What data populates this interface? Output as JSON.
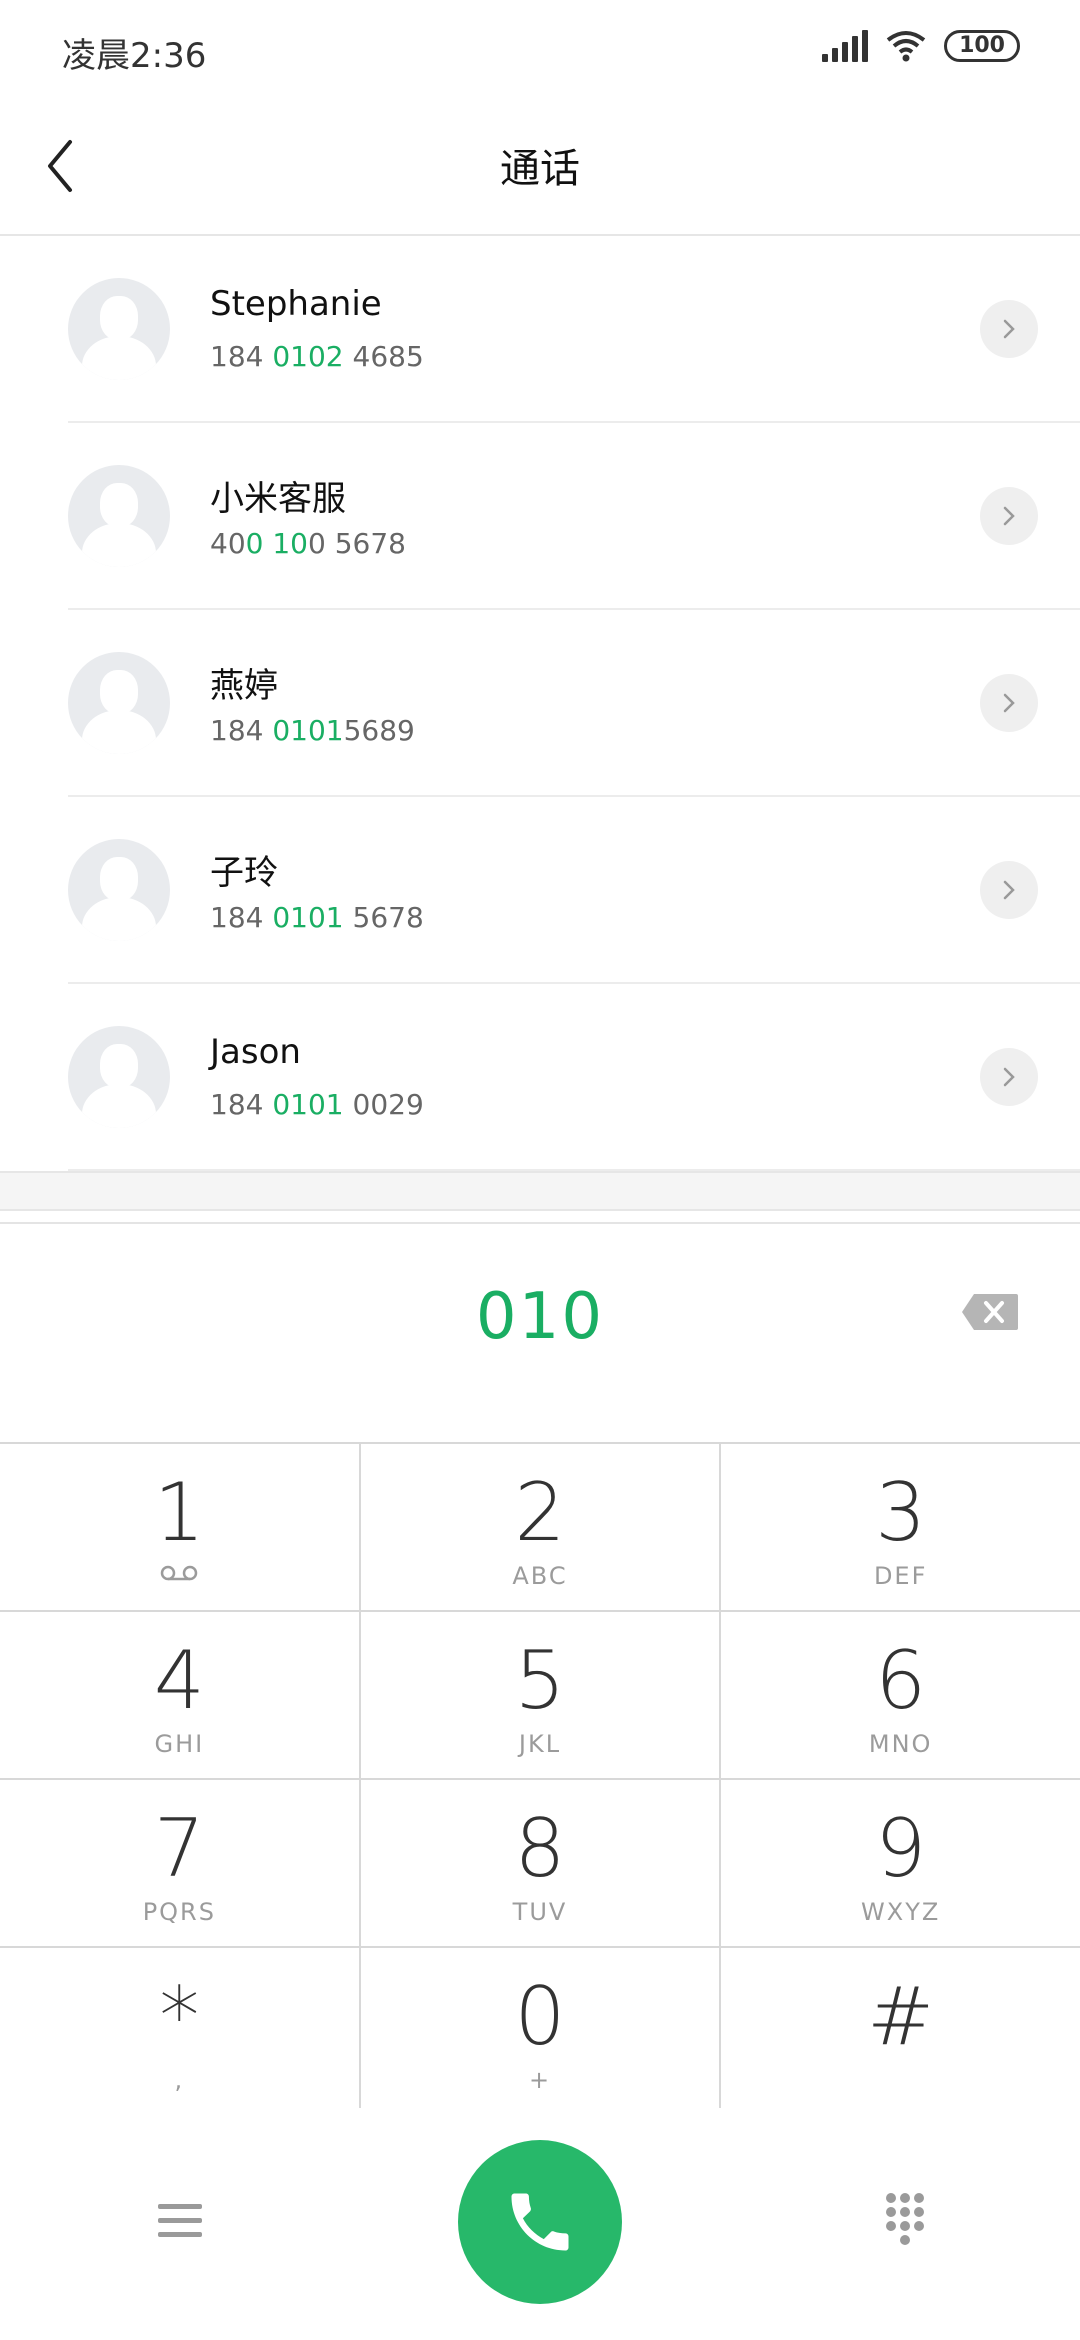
{
  "status_bar": {
    "time": "凌晨2:36",
    "battery": "100"
  },
  "header": {
    "title": "通话"
  },
  "contacts": [
    {
      "name": "Stephanie",
      "number_parts": [
        "184 ",
        "0102",
        " 4685"
      ]
    },
    {
      "name": "小米客服",
      "number_parts": [
        "40",
        "0 10",
        "0 5678"
      ]
    },
    {
      "name": "燕婷",
      "number_parts": [
        "184 ",
        "0101",
        "5689"
      ]
    },
    {
      "name": "子玲",
      "number_parts": [
        "184 ",
        "0101",
        " 5678"
      ]
    },
    {
      "name": "Jason",
      "number_parts": [
        "184 ",
        "0101",
        " 0029"
      ]
    }
  ],
  "input": {
    "digits": "010"
  },
  "keypad": [
    {
      "num": "1",
      "sub": ""
    },
    {
      "num": "2",
      "sub": "ABC"
    },
    {
      "num": "3",
      "sub": "DEF"
    },
    {
      "num": "4",
      "sub": "GHI"
    },
    {
      "num": "5",
      "sub": "JKL"
    },
    {
      "num": "6",
      "sub": "MNO"
    },
    {
      "num": "7",
      "sub": "PQRS"
    },
    {
      "num": "8",
      "sub": "TUV"
    },
    {
      "num": "9",
      "sub": "WXYZ"
    },
    {
      "num": "*",
      "sub": ","
    },
    {
      "num": "0",
      "sub": "+"
    },
    {
      "num": "#",
      "sub": ""
    }
  ],
  "icons": {
    "back": "chevron-left-icon",
    "backspace": "backspace-icon",
    "menu": "menu-icon",
    "call": "phone-icon",
    "dialpad": "dialpad-icon",
    "voicemail": "voicemail-icon"
  },
  "colors": {
    "accent": "#1aae63",
    "call_button": "#27b86a"
  }
}
